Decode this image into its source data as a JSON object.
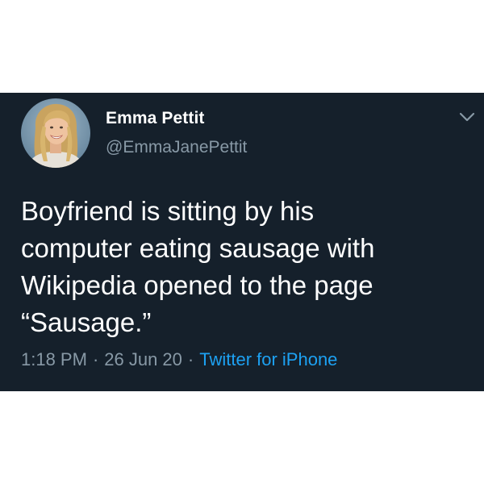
{
  "tweet": {
    "author": {
      "display_name": "Emma Pettit",
      "handle": "@EmmaJanePettit",
      "avatar_icon": "profile-photo"
    },
    "menu_icon": "chevron-down-icon",
    "text_lines": [
      "Boyfriend is sitting by his",
      "computer eating sausage with",
      "Wikipedia opened to the page",
      "“Sausage.”"
    ],
    "time": "1:18 PM",
    "date": "26 Jun 20",
    "separator": "·",
    "source": "Twitter for iPhone"
  },
  "colors": {
    "card_background": "#15202b",
    "text_primary": "#ffffff",
    "text_secondary": "#8899a6",
    "accent": "#1da1f2"
  }
}
